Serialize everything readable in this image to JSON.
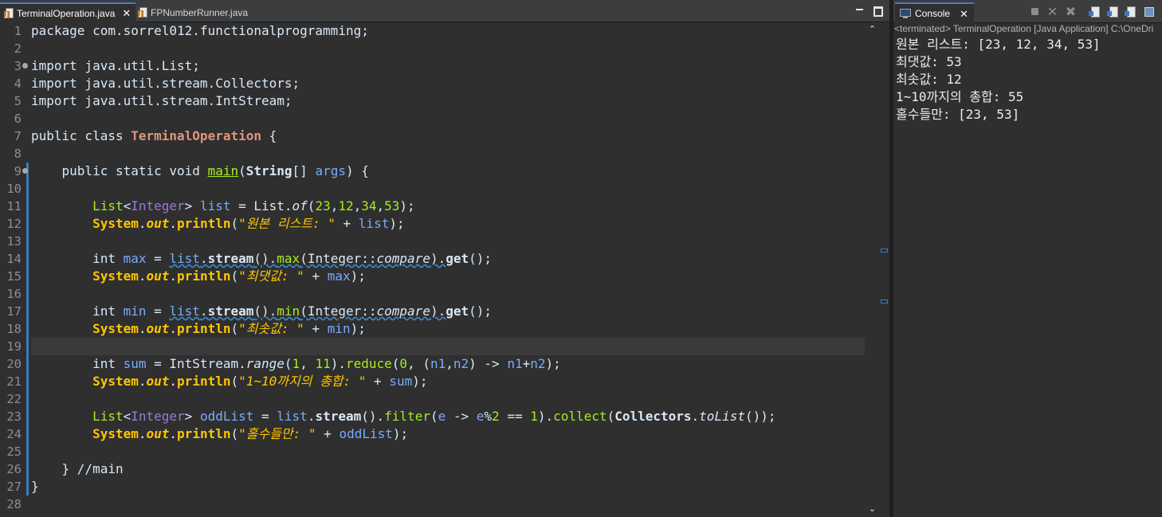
{
  "editor": {
    "tabs": [
      {
        "label": "TerminalOperation.java",
        "active": true
      },
      {
        "label": "FPNumberRunner.java",
        "active": false
      }
    ],
    "current_line": 19,
    "line_numbers": [
      "1",
      "2",
      "3",
      "4",
      "5",
      "6",
      "7",
      "8",
      "9",
      "10",
      "11",
      "12",
      "13",
      "14",
      "15",
      "16",
      "17",
      "18",
      "19",
      "20",
      "21",
      "22",
      "23",
      "24",
      "25",
      "26",
      "27",
      "28"
    ],
    "code": {
      "l1": {
        "a": "package com.sorrel012.functionalprogramming;"
      },
      "l3": {
        "a": "import java.util.List;"
      },
      "l4": {
        "a": "import java.util.stream.Collectors;"
      },
      "l5": {
        "a": "import java.util.stream.IntStream;"
      },
      "l7": {
        "a": "public class ",
        "b": "TerminalOperation",
        "c": " {"
      },
      "l9": {
        "a": "    public static void ",
        "b": "main",
        "c": "(",
        "d": "String",
        "e": "[] ",
        "f": "args",
        "g": ") {"
      },
      "l11": {
        "a": "        ",
        "b": "List",
        "c": "<",
        "d": "Integer",
        "e": "> ",
        "f": "list",
        "g": " = List.",
        "h": "of",
        "i": "(",
        "j": "23",
        "k": ",",
        "l": "12",
        "m": ",",
        "n": "34",
        "o": ",",
        "p": "53",
        "q": ");"
      },
      "l12": {
        "a": "        ",
        "b": "System",
        "c": ".",
        "d": "out",
        "e": ".",
        "f": "println",
        "g": "(",
        "h": "\"원본 리스트: \"",
        "i": " + ",
        "j": "list",
        "k": ");"
      },
      "l14": {
        "a": "        int ",
        "b": "max",
        "c": " = ",
        "d": "list",
        "e": ".",
        "f": "stream",
        "g": "().",
        "h": "max",
        "i": "(Integer::",
        "j": "compare",
        "k": ").",
        "l": "get",
        "m": "();"
      },
      "l15": {
        "a": "        ",
        "b": "System",
        "c": ".",
        "d": "out",
        "e": ".",
        "f": "println",
        "g": "(",
        "h": "\"최댓값: \"",
        "i": " + ",
        "j": "max",
        "k": ");"
      },
      "l17": {
        "a": "        int ",
        "b": "min",
        "c": " = ",
        "d": "list",
        "e": ".",
        "f": "stream",
        "g": "().",
        "h": "min",
        "i": "(Integer::",
        "j": "compare",
        "k": ").",
        "l": "get",
        "m": "();"
      },
      "l18": {
        "a": "        ",
        "b": "System",
        "c": ".",
        "d": "out",
        "e": ".",
        "f": "println",
        "g": "(",
        "h": "\"최솟값: \"",
        "i": " + ",
        "j": "min",
        "k": ");"
      },
      "l20": {
        "a": "        int ",
        "b": "sum",
        "c": " = IntStream.",
        "d": "range",
        "e": "(",
        "f": "1",
        "g": ", ",
        "h": "11",
        "i": ").",
        "j": "reduce",
        "k": "(",
        "l": "0",
        "m": ", (",
        "n": "n1",
        "o": ",",
        "p": "n2",
        "q": ") -> ",
        "r": "n1",
        "s": "+",
        "t": "n2",
        "u": ");"
      },
      "l21": {
        "a": "        ",
        "b": "System",
        "c": ".",
        "d": "out",
        "e": ".",
        "f": "println",
        "g": "(",
        "h": "\"1~10까지의 총합: \"",
        "i": " + ",
        "j": "sum",
        "k": ");"
      },
      "l23": {
        "a": "        ",
        "b": "List",
        "c": "<",
        "d": "Integer",
        "e": "> ",
        "f": "oddList",
        "g": " = ",
        "h": "list",
        "i": ".",
        "j": "stream",
        "k": "().",
        "l": "filter",
        "m": "(",
        "n": "e",
        "o": " -> ",
        "p": "e",
        "q": "%",
        "r": "2",
        "s": " == ",
        "t": "1",
        "u": ").",
        "v": "collect",
        "w": "(",
        "x": "Collectors",
        "y": ".",
        "z": "toList",
        "z2": "());"
      },
      "l24": {
        "a": "        ",
        "b": "System",
        "c": ".",
        "d": "out",
        "e": ".",
        "f": "println",
        "g": "(",
        "h": "\"홀수들만: \"",
        "i": " + ",
        "j": "oddList",
        "k": ");"
      },
      "l26": {
        "a": "    } //main"
      },
      "l27": {
        "a": "}"
      }
    }
  },
  "console": {
    "tab_label": "Console",
    "header": "<terminated> TerminalOperation [Java Application] C:\\OneDri",
    "output": [
      "원본 리스트: [23, 12, 34, 53]",
      "최댓값: 53",
      "최솟값: 12",
      "1~10까지의 총합: 55",
      "홀수들만: [23, 53]"
    ]
  },
  "colors": {
    "background": "#2f2f2f",
    "keyword": "#d9e8f7",
    "class_name": "#e0957b",
    "type_param": "#9a79d6",
    "method": "#a7ec21",
    "identifier": "#79abff",
    "string": "#ffc600",
    "number": "#6897bb",
    "static_field": "#8dd9ed",
    "accent": "#4d7dbd"
  },
  "icons": [
    "java-file-icon",
    "close-icon",
    "minimize-icon",
    "maximize-icon",
    "console-icon",
    "terminate-icon",
    "remove-launch-icon",
    "remove-all-icon",
    "scroll-lock-icon",
    "word-wrap-icon",
    "pin-console-icon",
    "scroll-up-arrow-icon",
    "scroll-down-arrow-icon"
  ]
}
